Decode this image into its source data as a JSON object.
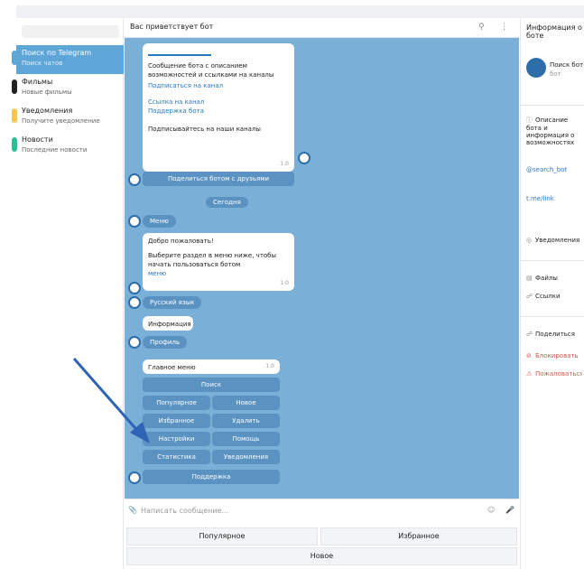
{
  "header": {
    "title": "Вас приветствует бот"
  },
  "info_title": "Информация о боте",
  "chats": [
    {
      "title": "Поиск по Telegram",
      "sub": "Поиск чатов",
      "active": true,
      "color": "#5ea6d8"
    },
    {
      "title": "Фильмы",
      "sub": "Новые фильмы",
      "active": false,
      "color": "#222222"
    },
    {
      "title": "Уведомления",
      "sub": "Получите уведомление",
      "active": false,
      "color": "#f3c74f"
    },
    {
      "title": "Новости",
      "sub": "Последние новости",
      "active": false,
      "color": "#2bbf9a"
    }
  ],
  "messages": {
    "top_text": "Сообщение бота с описанием возможностей и ссылками на каналы",
    "top_link": "Подписаться на канал",
    "top_links": [
      "Ссылка на канал",
      "Поддержка бота"
    ],
    "top_footer": "Подписывайтесь на наши каналы",
    "top_time": "1:0",
    "share_button": "Поделиться ботом с друзьями",
    "date_pill": "Сегодня",
    "bot_name_pill": "Меню",
    "welcome_title": "Добро пожаловать!",
    "welcome_body": "Выберите раздел в меню ниже, чтобы начать пользоваться ботом",
    "welcome_link": "меню",
    "welcome_time": "1:0",
    "lang_pill": "Русский язык",
    "info_bubble": "Информация",
    "profile_pill": "Профиль",
    "menu_label": "Главное меню",
    "menu_time": "1:0"
  },
  "keyboard": {
    "row1": "Поиск",
    "row2": [
      "Популярное",
      "Новое"
    ],
    "row3": [
      "Избранное",
      "Удалить"
    ],
    "row4": [
      "Настройки",
      "Помощь"
    ],
    "row5": [
      "Статистика",
      "Уведомления"
    ],
    "row6": "Поддержка"
  },
  "input": {
    "placeholder": "Написать сообщение..."
  },
  "reply_keyboard": {
    "left": "Популярное",
    "right": "Избранное",
    "bottom": "Новое"
  },
  "right_panel": {
    "name": "Поиск бот",
    "status": "бот",
    "desc": "Описание бота и информация о возможностях",
    "username": "@search_bot",
    "link": "t.me/link",
    "notifications": "Уведомления",
    "files": "Файлы",
    "links": "Ссылки",
    "share": "Поделиться",
    "block": "Блокировать",
    "report": "Пожаловаться"
  }
}
